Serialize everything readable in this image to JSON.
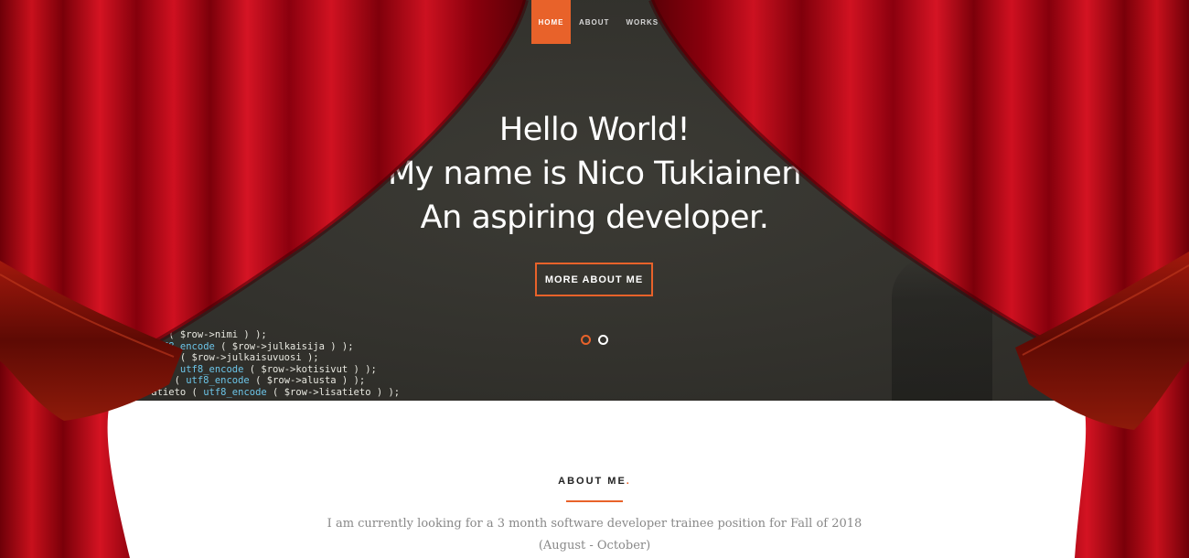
{
  "nav": {
    "items": [
      {
        "label": "HOME",
        "active": true
      },
      {
        "label": "ABOUT",
        "active": false
      },
      {
        "label": "WORKS",
        "active": false
      }
    ]
  },
  "hero": {
    "line1": "Hello World!",
    "line2": "My name is Nico Tukiainen",
    "line3": "An aspiring developer.",
    "cta_label": "MORE ABOUT ME",
    "slides": [
      {
        "active": true
      },
      {
        "active": false
      }
    ],
    "code_lines": [
      "    ue ( $row->nimi ) );",
      "    utf8_encode ( $row->julkaisija ) );",
      "    uosi ( $row->julkaisuvuosi );",
      "    ut ( utf8_encode ( $row->kotisivut ) );",
      "    rmi ( utf8_encode ( $row->alusta ) );",
      "    atieto ( utf8_encode ( $row->lisatieto ) );"
    ]
  },
  "about": {
    "heading": "ABOUT ME",
    "heading_accent": ".",
    "text": "I am currently looking for a 3 month software developer trainee position for Fall of 2018 (August - October)"
  },
  "colors": {
    "accent": "#e8622a",
    "curtain": "#b5000f",
    "hero_bg": "#35342f"
  }
}
